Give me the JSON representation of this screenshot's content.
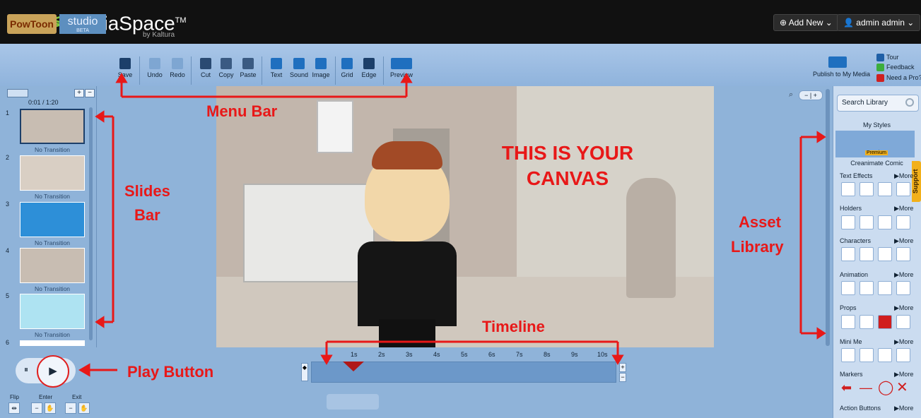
{
  "header": {
    "brand": "MediaSpace",
    "trademark": "TM",
    "brand_sub": "by Kaltura",
    "add_new": "⊕ Add New ⌄",
    "user": "👤 admin admin ⌄"
  },
  "toolbar": {
    "logo": "PowToon",
    "studio": "studio",
    "beta": "BETA",
    "tools": [
      "Save",
      "Undo",
      "Redo",
      "Cut",
      "Copy",
      "Paste",
      "Text",
      "Sound",
      "Image",
      "Grid",
      "Edge",
      "Preview"
    ],
    "publish": "Publish to My Media",
    "tour": "Tour",
    "feedback": "Feedback",
    "need_pro": "Need a Pro?"
  },
  "slides": {
    "counter": "0:01 / 1:20",
    "transition_label": "No Transition",
    "numbers": [
      "1",
      "2",
      "3",
      "4",
      "5",
      "6"
    ]
  },
  "canvas": {
    "text_line1": "THIS IS YOUR",
    "text_line2": "CANVAS"
  },
  "asset_library": {
    "search_placeholder": "Search Library",
    "my_styles": "My Styles",
    "premium": "Premium",
    "style_name": "Creanimate Comic",
    "more": "▶More",
    "categories": [
      "Text Effects",
      "Holders",
      "Characters",
      "Animation",
      "Props",
      "Mini Me",
      "Markers",
      "Action Buttons"
    ],
    "support": "Support"
  },
  "timeline": {
    "ticks": [
      "1s",
      "2s",
      "3s",
      "4s",
      "5s",
      "6s",
      "7s",
      "8s",
      "9s",
      "10s"
    ]
  },
  "bottom": {
    "flip": "Flip",
    "enter": "Enter",
    "exit": "Exit"
  },
  "annotations": {
    "menu_bar": "Menu Bar",
    "slides_bar_1": "Slides",
    "slides_bar_2": "Bar",
    "asset_1": "Asset",
    "asset_2": "Library",
    "timeline": "Timeline",
    "play_button": "Play Button"
  },
  "colors": {
    "annotation": "#e81818",
    "toolbar_bg": "#a9c6e8",
    "header_bg": "#111111"
  }
}
